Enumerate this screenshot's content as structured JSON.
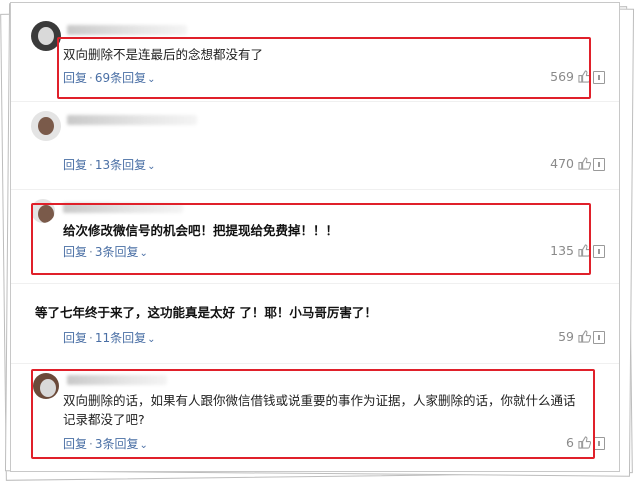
{
  "comments": [
    {
      "text": "双向删除不是连最后的念想都没有了",
      "reply_label": "回复",
      "replies": "69条回复",
      "likes": "569"
    },
    {
      "text": "",
      "reply_label": "回复",
      "replies": "13条回复",
      "likes": "470"
    },
    {
      "text": "给次修改微信号的机会吧！把提现给免费掉！！！",
      "reply_label": "回复",
      "replies": "3条回复",
      "likes": "135"
    },
    {
      "text": "等了七年终于来了，这功能真是太好 了！耶！小马哥厉害了！",
      "reply_label": "回复",
      "replies": "11条回复",
      "likes": "59"
    },
    {
      "text": "双向删除的话，如果有人跟你微信借钱或说重要的事作为证据，人家删除的话，你就什么通话记录都没了吧?",
      "reply_label": "回复",
      "replies": "3条回复",
      "likes": "6"
    }
  ],
  "colors": {
    "highlight": "#e0202a",
    "reply_link": "#4a6fa5",
    "like_count": "#8a8a8a"
  },
  "icons": [
    "thumbs-up-icon",
    "report-icon",
    "chevron-down-icon"
  ]
}
